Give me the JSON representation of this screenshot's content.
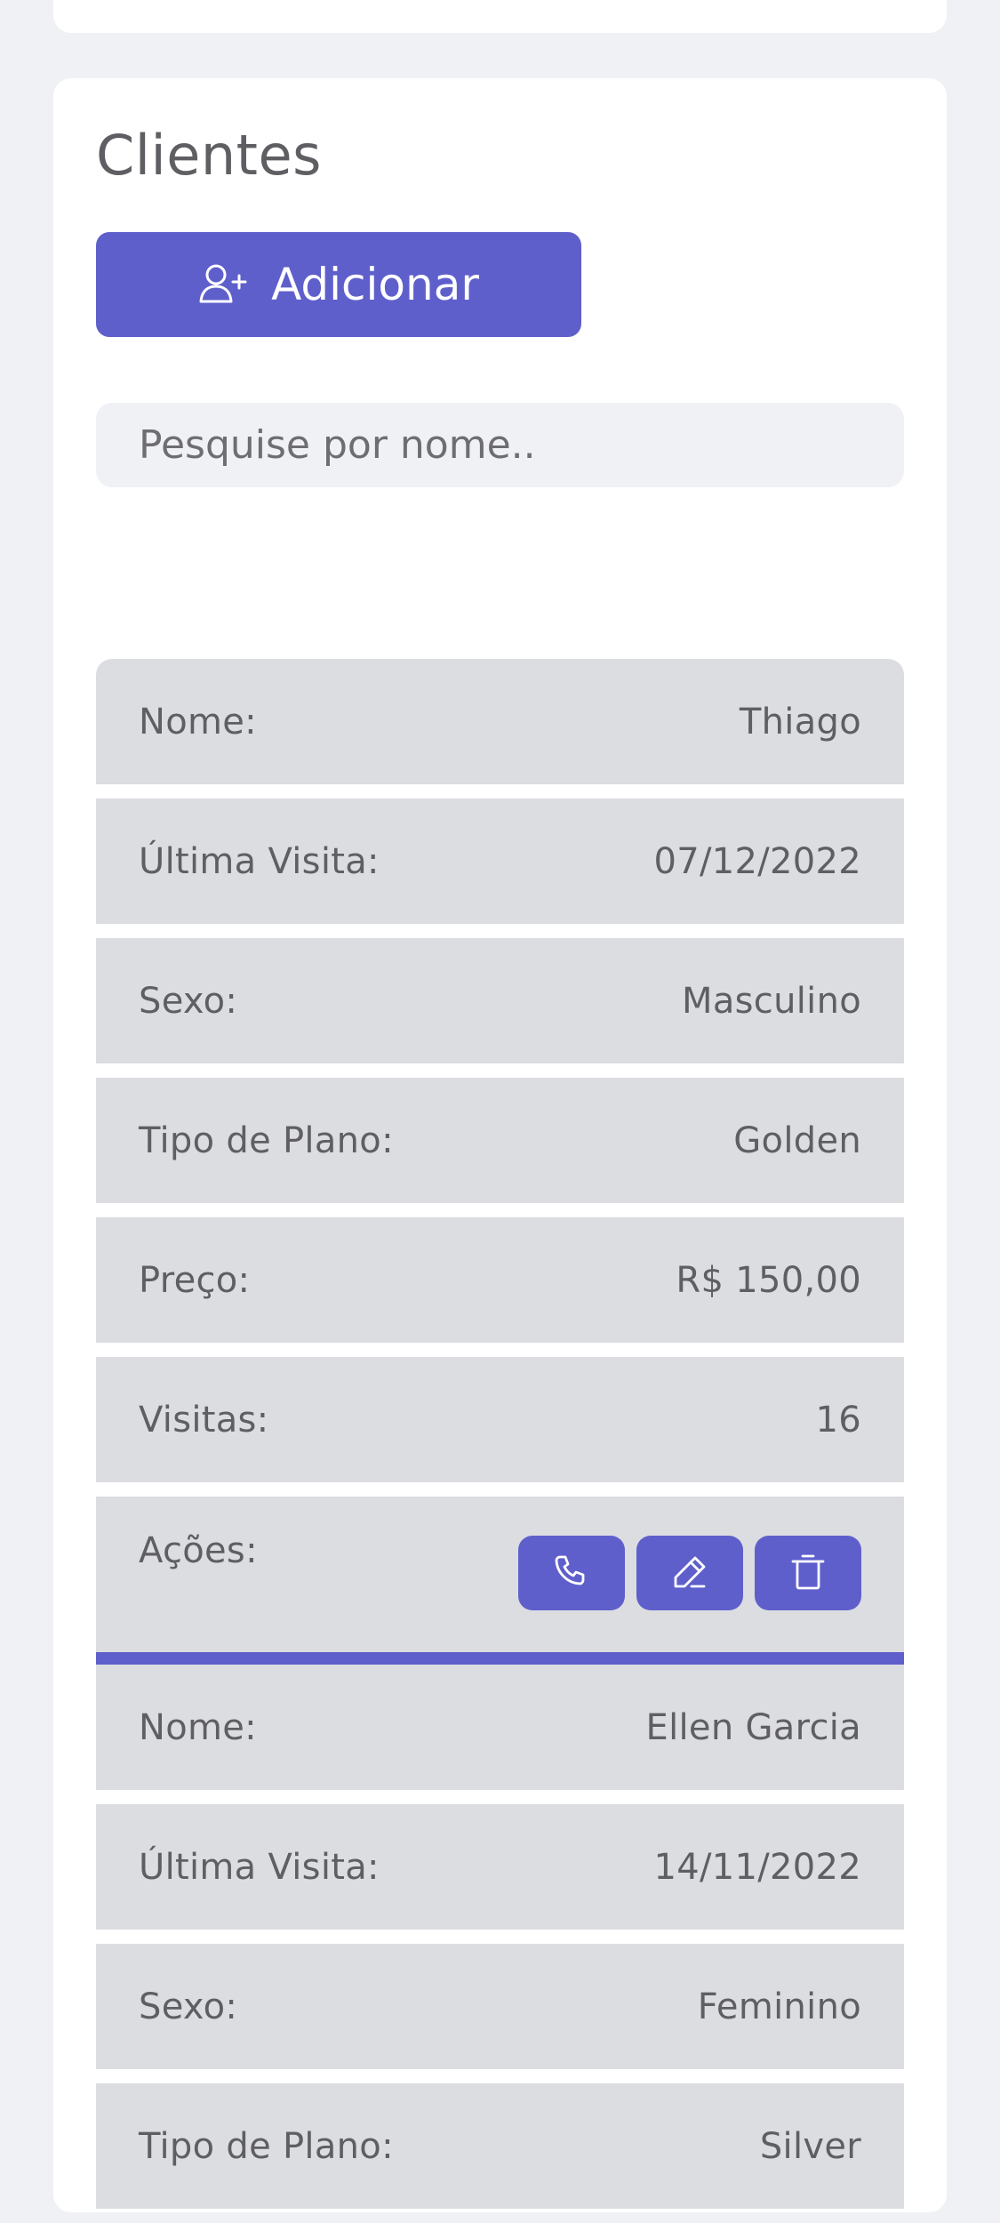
{
  "page": {
    "title": "Clientes",
    "add_button_label": "Adicionar",
    "search_placeholder": "Pesquise por nome.."
  },
  "labels": {
    "name": "Nome:",
    "last_visit": "Última Visita:",
    "sex": "Sexo:",
    "plan": "Tipo de Plano:",
    "price": "Preço:",
    "visits": "Visitas:",
    "actions": "Ações:"
  },
  "clients": [
    {
      "name": "Thiago",
      "last_visit": "07/12/2022",
      "sex": "Masculino",
      "plan": "Golden",
      "price": "R$ 150,00",
      "visits": "16"
    },
    {
      "name": "Ellen Garcia",
      "last_visit": "14/11/2022",
      "sex": "Feminino",
      "plan": "Silver"
    }
  ],
  "icons": {
    "add_user": "user-plus-icon",
    "call": "phone-icon",
    "edit": "pencil-icon",
    "delete": "trash-icon"
  },
  "colors": {
    "accent": "#5f5fcc",
    "background": "#f0f1f5",
    "card": "#ffffff",
    "row": "#dcdde1",
    "text": "#5f5f63"
  }
}
